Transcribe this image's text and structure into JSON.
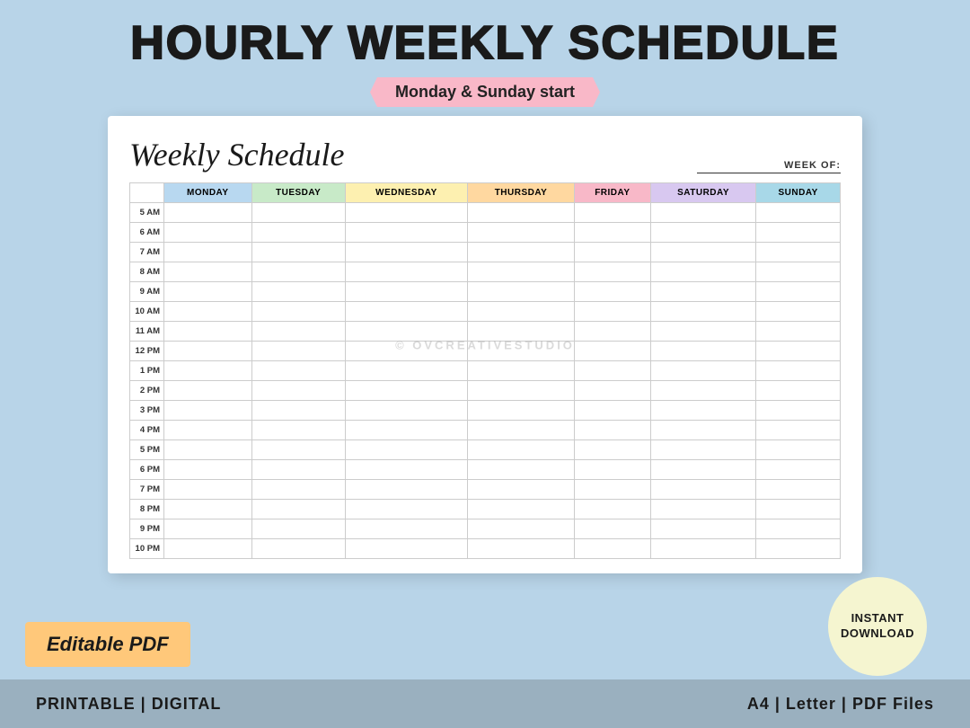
{
  "page": {
    "background_color": "#b8d4e8"
  },
  "header": {
    "main_title": "HOURLY WEEKLY SCHEDULE",
    "sub_banner": "Monday & Sunday start"
  },
  "paper": {
    "title": "Weekly Schedule",
    "week_of_label": "WEEK OF:",
    "watermark": "© OVCREATIVESTUDIO",
    "days": [
      {
        "label": "MONDAY",
        "class": "th-monday"
      },
      {
        "label": "TUESDAY",
        "class": "th-tuesday"
      },
      {
        "label": "WEDNESDAY",
        "class": "th-wednesday"
      },
      {
        "label": "THURSDAY",
        "class": "th-thursday"
      },
      {
        "label": "FRIDAY",
        "class": "th-friday"
      },
      {
        "label": "SATURDAY",
        "class": "th-saturday"
      },
      {
        "label": "SUNDAY",
        "class": "th-sunday"
      }
    ],
    "time_slots": [
      "5 AM",
      "6 AM",
      "7 AM",
      "8 AM",
      "9 AM",
      "10 AM",
      "11 AM",
      "12 PM",
      "1 PM",
      "2 PM",
      "3 PM",
      "4 PM",
      "5 PM",
      "6 PM",
      "7 PM",
      "8 PM",
      "9 PM",
      "10 PM"
    ]
  },
  "badges": {
    "pdf_label": "Editable PDF",
    "download_line1": "INSTANT",
    "download_line2": "DOWNLOAD"
  },
  "bottom_bar": {
    "left": "PRINTABLE | DIGITAL",
    "right": "A4 | Letter | PDF Files"
  }
}
